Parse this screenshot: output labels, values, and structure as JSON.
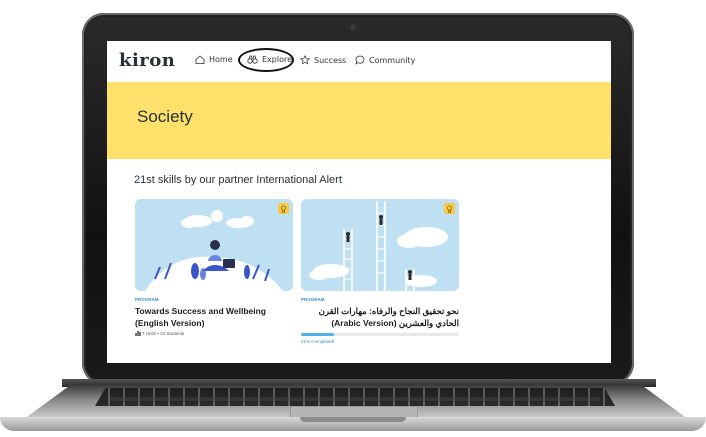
{
  "nav": {
    "logo": "kiron",
    "items": [
      {
        "label": "Home",
        "icon": "home-icon"
      },
      {
        "label": "Explore",
        "icon": "binoculars-icon"
      },
      {
        "label": "Success",
        "icon": "star-icon"
      },
      {
        "label": "Community",
        "icon": "chat-bubble-icon"
      }
    ]
  },
  "banner": {
    "title": "Society",
    "color": "#fde16a"
  },
  "section": {
    "title": "21st skills by our partner International Alert"
  },
  "cards": [
    {
      "tag": "PROGRAM",
      "title": "Towards Success and Wellbeing (English Version)",
      "meta": "7 Units • 24 Students",
      "badge_icon": "award-icon"
    },
    {
      "tag": "PROGRAM",
      "title": "نحو تحقيق النجاح والرفاه: مهارات القرن الحادي والعشرين (Arabic Version)",
      "progress_value": 0.21,
      "progress_label": "21% Completed!",
      "badge_icon": "award-icon"
    }
  ],
  "colors": {
    "accent": "#2f8fd1",
    "progress": "#4fb3e6",
    "badge": "#f7c948"
  }
}
